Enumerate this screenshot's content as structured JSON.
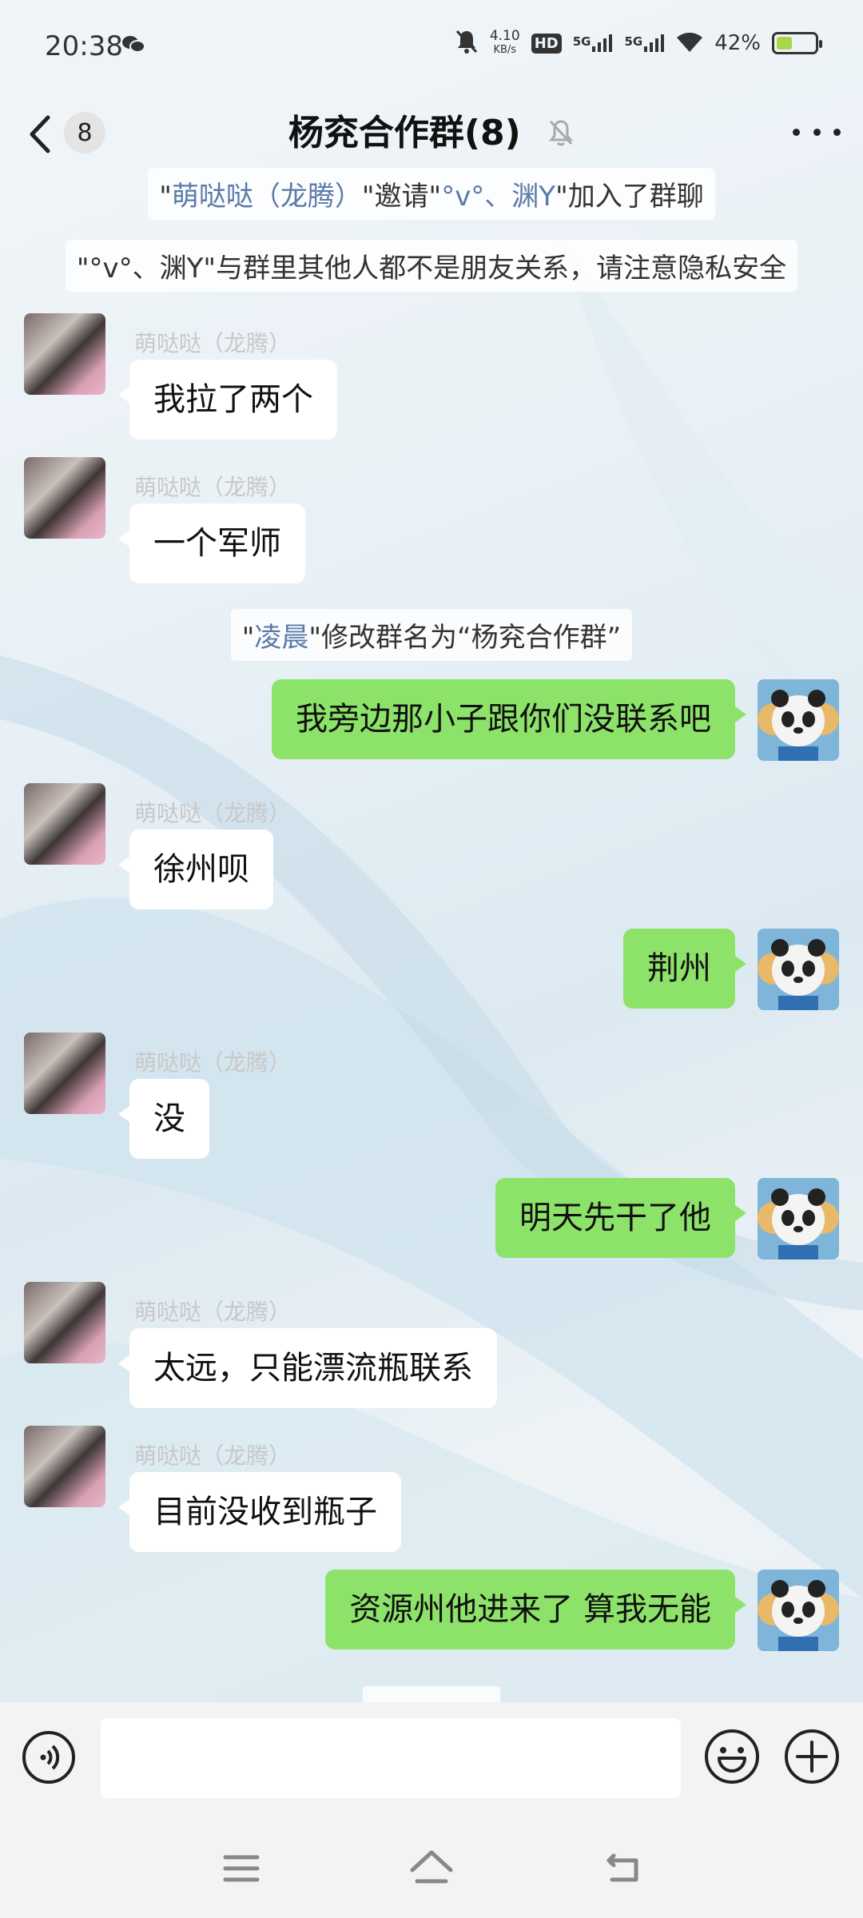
{
  "status_bar": {
    "time": "20:38",
    "net_speed_value": "4.10",
    "net_speed_unit": "KB/s",
    "hd_label": "HD",
    "sim1_label": "5G",
    "sim2_label": "5G",
    "battery_percent": "42%",
    "battery_level": 0.42
  },
  "header": {
    "unread_count": "8",
    "title": "杨兖合作群(8)"
  },
  "system_messages": [
    {
      "parts": [
        "\"",
        "萌哒哒（龙腾）",
        "\"邀请\"",
        "°v°、渊Y",
        "\"加入了群聊"
      ]
    },
    {
      "text": "\"°v°、渊Y\"与群里其他人都不是朋友关系，请注意隐私安全"
    },
    {
      "parts": [
        "\"",
        "凌晨",
        "\"修改群名为“杨兖合作群”"
      ]
    }
  ],
  "messages": [
    {
      "side": "left",
      "sender": "萌哒哒（龙腾）",
      "text": "我拉了两个"
    },
    {
      "side": "left",
      "sender": "萌哒哒（龙腾）",
      "text": "一个军师"
    },
    {
      "side": "right",
      "text": "我旁边那小子跟你们没联系吧"
    },
    {
      "side": "left",
      "sender": "萌哒哒（龙腾）",
      "text": "徐州呗"
    },
    {
      "side": "right",
      "text": "荆州"
    },
    {
      "side": "left",
      "sender": "萌哒哒（龙腾）",
      "text": "没"
    },
    {
      "side": "right",
      "text": "明天先干了他"
    },
    {
      "side": "left",
      "sender": "萌哒哒（龙腾）",
      "text": "太远，只能漂流瓶联系"
    },
    {
      "side": "left",
      "sender": "萌哒哒（龙腾）",
      "text": "目前没收到瓶子"
    },
    {
      "side": "right",
      "text": "资源州他进来了 算我无能"
    }
  ],
  "input": {
    "value": "",
    "placeholder": ""
  },
  "colors": {
    "self_bubble": "#8de36a",
    "other_bubble": "#ffffff",
    "system_highlight": "#5b7aa8",
    "sender_name": "#c8c8c8"
  }
}
